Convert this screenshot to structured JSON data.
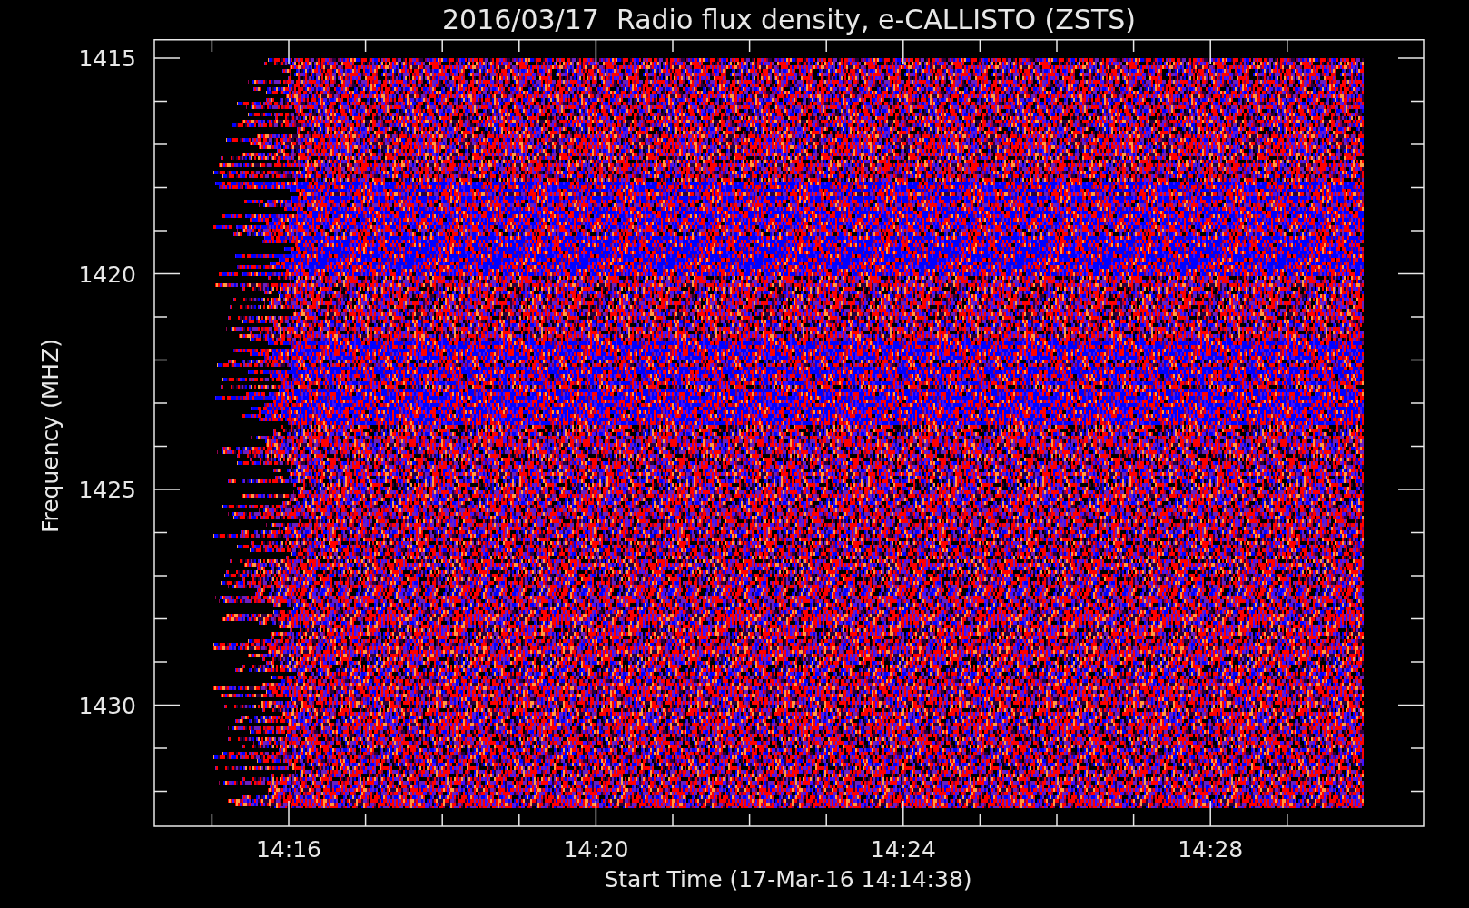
{
  "title": "2016/03/17  Radio flux density, e-CALLISTO (ZSTS)",
  "y_axis": {
    "label": "Frequency (MHZ)",
    "ticks": [
      "1415",
      "1420",
      "1425",
      "1430"
    ]
  },
  "x_axis": {
    "label": "Start Time (17-Mar-16 14:14:38)",
    "ticks": [
      "14:16",
      "14:20",
      "14:24",
      "14:28"
    ]
  }
}
